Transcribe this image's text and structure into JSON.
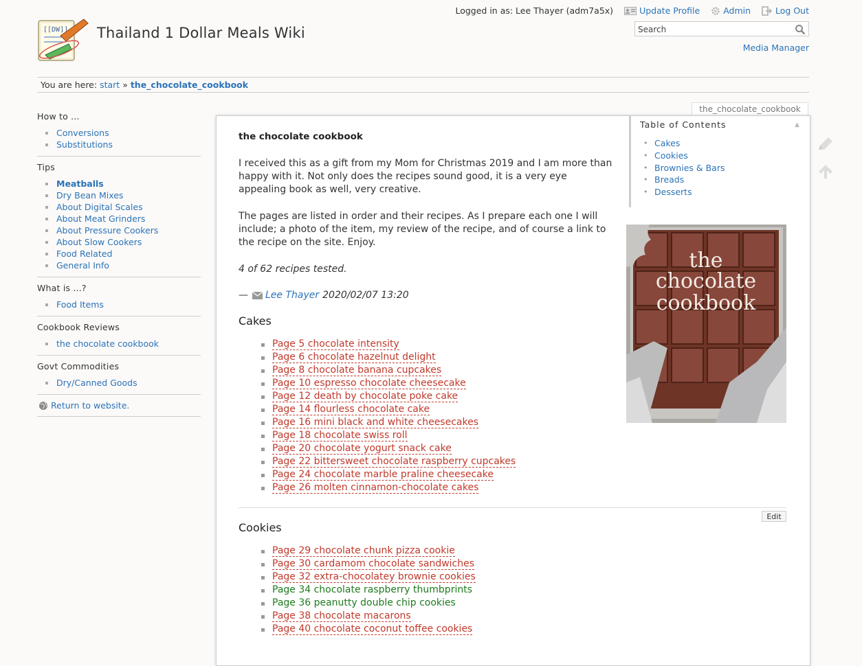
{
  "site": {
    "title": "Thailand 1 Dollar Meals Wiki",
    "logo_text": "[[DW]]"
  },
  "user_tools": {
    "logged_in_label": "Logged in as: Lee Thayer (adm7a5x)",
    "update_profile": "Update Profile",
    "admin": "Admin",
    "log_out": "Log Out"
  },
  "search": {
    "placeholder": "Search"
  },
  "site_tools": {
    "media_manager": "Media Manager"
  },
  "breadcrumb": {
    "prefix": "You are here:",
    "items": [
      "start",
      "the_chocolate_cookbook"
    ],
    "separator": "»"
  },
  "sidebar": {
    "sections": [
      {
        "heading": "How to ...",
        "items": [
          "Conversions",
          "Substitutions"
        ]
      },
      {
        "heading": "Tips",
        "items": [
          "Meatballs",
          "Dry Bean Mixes",
          "About Digital Scales",
          "About Meat Grinders",
          "About Pressure Cookers",
          "About Slow Cookers",
          "Food Related",
          "General Info"
        ]
      },
      {
        "heading": "What is ...?",
        "items": [
          "Food Items"
        ]
      },
      {
        "heading": "Cookbook Reviews",
        "items": [
          "the chocolate cookbook"
        ]
      },
      {
        "heading": "Govt Commodities",
        "items": [
          "Dry/Canned Goods"
        ]
      }
    ],
    "return_link": "Return to website."
  },
  "page": {
    "tab_label": "the_chocolate_cookbook",
    "title": "the chocolate cookbook",
    "intro": "I received this as a gift from my Mom for Christmas 2019 and I am more than happy with it. Not only does the recipes sound good, it is a very eye appealing book as well, very creative.",
    "pages_note": "The pages are listed in order and their recipes. As I prepare each one I will include; a photo of the item, my review of the recipe, and of course a link to the recipe on the site. Enjoy.",
    "tested": "4 of 62 recipes tested.",
    "signature": {
      "dash": "—",
      "author": "Lee Thayer",
      "date": "2020/02/07 13:20"
    },
    "book_cover_text": [
      "the",
      "chocolate",
      "cookbook"
    ],
    "edit_button": "Edit"
  },
  "toc": {
    "heading": "Table of Contents",
    "toggle": "▲",
    "items": [
      "Cakes",
      "Cookies",
      "Brownies & Bars",
      "Breads",
      "Desserts"
    ]
  },
  "sections": {
    "cakes": {
      "heading": "Cakes",
      "items": [
        "Page 5 chocolate intensity",
        "Page 6 chocolate hazelnut delight",
        "Page 8 chocolate banana cupcakes",
        "Page 10 espresso chocolate cheesecake",
        "Page 12 death by chocolate poke cake",
        "Page 14 flourless chocolate cake",
        "Page 16 mini black and white cheesecakes",
        "Page 18 chocolate swiss roll",
        "Page 20 chocolate yogurt snack cake",
        "Page 22 bittersweet chocolate raspberry cupcakes",
        "Page 24 chocolate marble praline cheesecake",
        "Page 26 molten cinnamon-chocolate cakes"
      ]
    },
    "cookies": {
      "heading": "Cookies",
      "items": [
        "Page 29 chocolate chunk pizza cookie",
        "Page 30 cardamom chocolate sandwiches",
        "Page 32 extra-chocolatey brownie cookies",
        "Page 34 chocolate raspberry thumbprints",
        "Page 36 peanutty double chip cookies",
        "Page 38 chocolate macarons",
        "Page 40 chocolate coconut toffee cookies"
      ]
    }
  },
  "colors": {
    "link": "#2b73b7",
    "missing_link": "#c0392b",
    "existing_link": "#1e7b1e",
    "chocolate": "#7a3b2a"
  }
}
